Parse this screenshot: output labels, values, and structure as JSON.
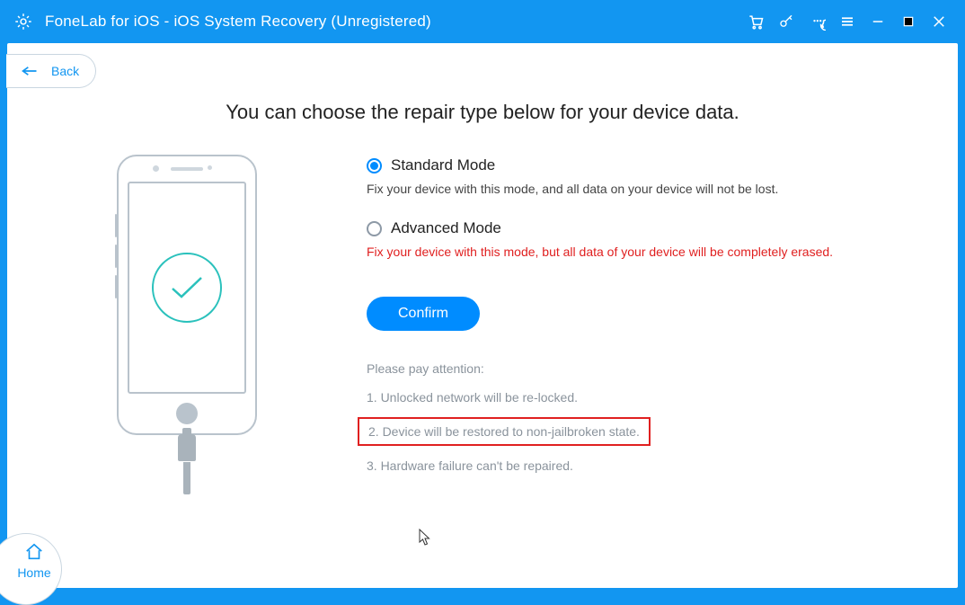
{
  "titlebar": {
    "title": "FoneLab for iOS - iOS System Recovery (Unregistered)"
  },
  "back_label": "Back",
  "headline": "You can choose the repair type below for your device data.",
  "modes": {
    "standard": {
      "title": "Standard Mode",
      "desc": "Fix your device with this mode, and all data on your device will not be lost.",
      "selected": true
    },
    "advanced": {
      "title": "Advanced Mode",
      "desc": "Fix your device with this mode, but all data of your device will be completely erased.",
      "selected": false
    }
  },
  "confirm_label": "Confirm",
  "attention": {
    "lead": "Please pay attention:",
    "items": [
      "1. Unlocked network will be re-locked.",
      "2. Device will be restored to non-jailbroken state.",
      "3. Hardware failure can't be repaired."
    ],
    "highlighted_index": 1
  },
  "home_label": "Home"
}
